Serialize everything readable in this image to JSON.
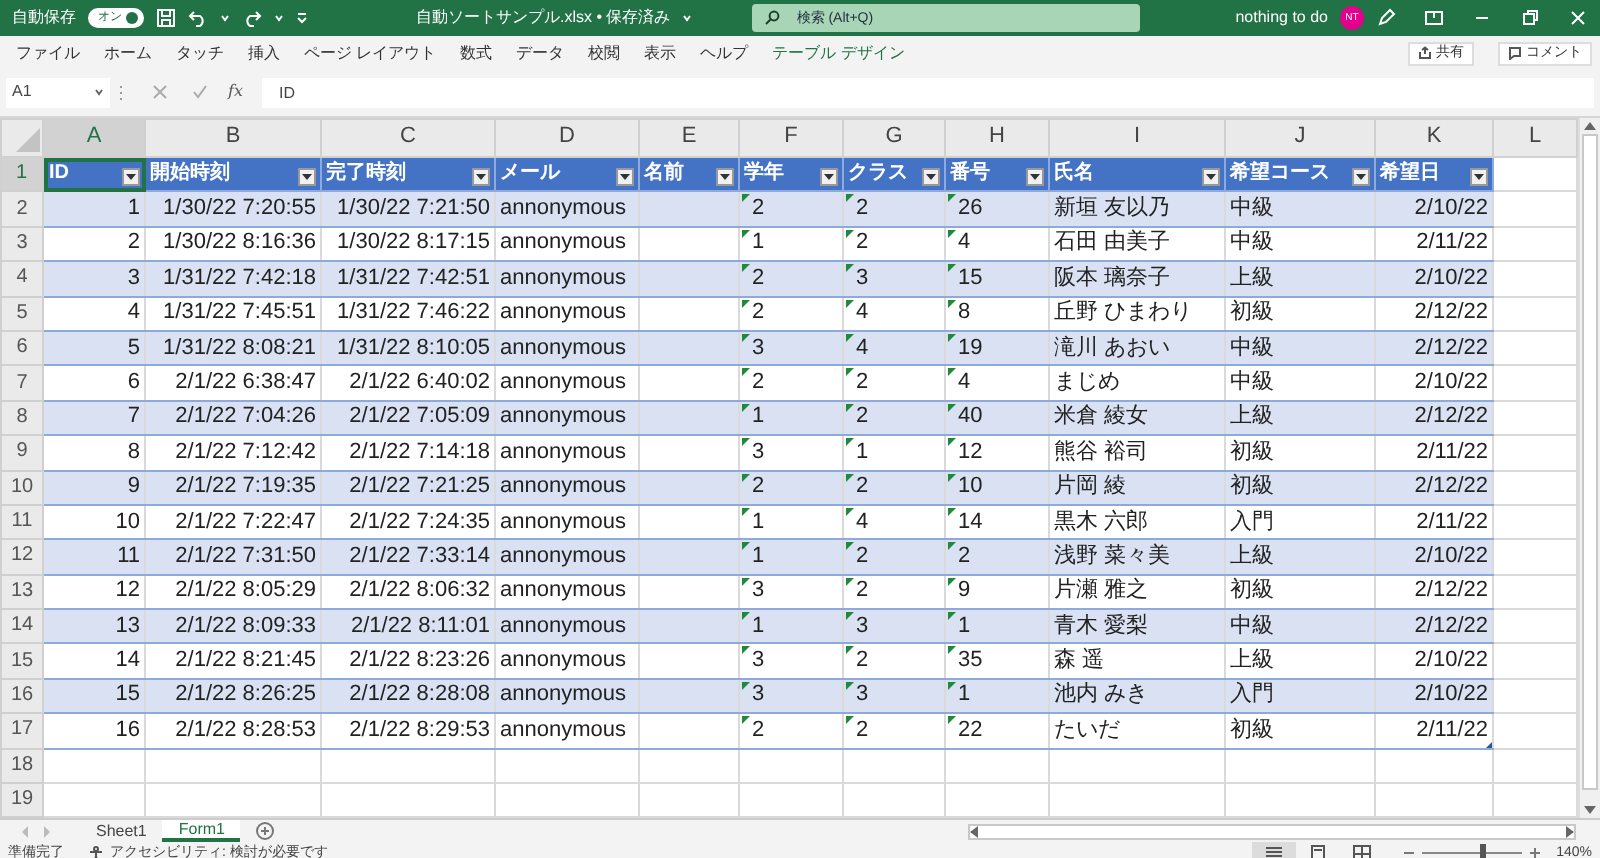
{
  "title_bar": {
    "autosave_label": "自動保存",
    "autosave_toggle": {
      "label": "オン",
      "on": true
    },
    "file_title": "自動ソートサンプル.xlsx • 保存済み",
    "search_placeholder": "検索 (Alt+Q)",
    "user_name": "nothing to do",
    "avatar_initials": "NT"
  },
  "ribbon_tabs": [
    {
      "label": "ファイル",
      "kind": "standard",
      "selected": false
    },
    {
      "label": "ホーム",
      "kind": "standard",
      "selected": false
    },
    {
      "label": "タッチ",
      "kind": "standard",
      "selected": false
    },
    {
      "label": "挿入",
      "kind": "standard",
      "selected": false
    },
    {
      "label": "ページ レイアウト",
      "kind": "standard",
      "selected": false
    },
    {
      "label": "数式",
      "kind": "standard",
      "selected": false
    },
    {
      "label": "データ",
      "kind": "standard",
      "selected": false
    },
    {
      "label": "校閲",
      "kind": "standard",
      "selected": false
    },
    {
      "label": "表示",
      "kind": "standard",
      "selected": false
    },
    {
      "label": "ヘルプ",
      "kind": "standard",
      "selected": false
    },
    {
      "label": "テーブル デザイン",
      "kind": "contextual",
      "selected": false
    }
  ],
  "share_button": "共有",
  "comment_button": "コメント",
  "formula_bar": {
    "name_box": "A1",
    "function_label": "fx",
    "value": "ID"
  },
  "sheet": {
    "columns": [
      {
        "letter": "A",
        "selected": true
      },
      {
        "letter": "B",
        "selected": false
      },
      {
        "letter": "C",
        "selected": false
      },
      {
        "letter": "D",
        "selected": false
      },
      {
        "letter": "E",
        "selected": false
      },
      {
        "letter": "F",
        "selected": false
      },
      {
        "letter": "G",
        "selected": false
      },
      {
        "letter": "H",
        "selected": false
      },
      {
        "letter": "I",
        "selected": false
      },
      {
        "letter": "J",
        "selected": false
      },
      {
        "letter": "K",
        "selected": false
      },
      {
        "letter": "L",
        "selected": false
      }
    ],
    "rows": [
      {
        "number": "1",
        "selected": true
      },
      {
        "number": "2",
        "selected": false
      },
      {
        "number": "3",
        "selected": false
      },
      {
        "number": "4",
        "selected": false
      },
      {
        "number": "5",
        "selected": false
      },
      {
        "number": "6",
        "selected": false
      },
      {
        "number": "7",
        "selected": false
      },
      {
        "number": "8",
        "selected": false
      },
      {
        "number": "9",
        "selected": false
      },
      {
        "number": "10",
        "selected": false
      },
      {
        "number": "11",
        "selected": false
      },
      {
        "number": "12",
        "selected": false
      },
      {
        "number": "13",
        "selected": false
      },
      {
        "number": "14",
        "selected": false
      },
      {
        "number": "15",
        "selected": false
      },
      {
        "number": "16",
        "selected": false
      },
      {
        "number": "17",
        "selected": false
      },
      {
        "number": "18",
        "selected": false
      },
      {
        "number": "19",
        "selected": false
      }
    ],
    "table": {
      "columns": [
        {
          "label": "ID",
          "kind": "number"
        },
        {
          "label": "開始時刻",
          "kind": "number"
        },
        {
          "label": "完了時刻",
          "kind": "number"
        },
        {
          "label": "メール",
          "kind": "text"
        },
        {
          "label": "名前",
          "kind": "text"
        },
        {
          "label": "学年",
          "kind": "text_number"
        },
        {
          "label": "クラス",
          "kind": "text_number"
        },
        {
          "label": "番号",
          "kind": "text_number"
        },
        {
          "label": "氏名",
          "kind": "text"
        },
        {
          "label": "希望コース",
          "kind": "text"
        },
        {
          "label": "希望日",
          "kind": "number"
        }
      ],
      "rows": [
        [
          "1",
          "1/30/22 7:20:55",
          "1/30/22 7:21:50",
          "annonymous",
          null,
          "2",
          "2",
          "26",
          "新垣 友以乃",
          "中級",
          "2/10/22"
        ],
        [
          "2",
          "1/30/22 8:16:36",
          "1/30/22 8:17:15",
          "annonymous",
          null,
          "1",
          "2",
          "4",
          "石田 由美子",
          "中級",
          "2/11/22"
        ],
        [
          "3",
          "1/31/22 7:42:18",
          "1/31/22 7:42:51",
          "annonymous",
          null,
          "2",
          "3",
          "15",
          "阪本 璃奈子",
          "上級",
          "2/10/22"
        ],
        [
          "4",
          "1/31/22 7:45:51",
          "1/31/22 7:46:22",
          "annonymous",
          null,
          "2",
          "4",
          "8",
          "丘野 ひまわり",
          "初級",
          "2/12/22"
        ],
        [
          "5",
          "1/31/22 8:08:21",
          "1/31/22 8:10:05",
          "annonymous",
          null,
          "3",
          "4",
          "19",
          "滝川 あおい",
          "中級",
          "2/12/22"
        ],
        [
          "6",
          "2/1/22 6:38:47",
          "2/1/22 6:40:02",
          "annonymous",
          null,
          "2",
          "2",
          "4",
          "まじめ",
          "中級",
          "2/10/22"
        ],
        [
          "7",
          "2/1/22 7:04:26",
          "2/1/22 7:05:09",
          "annonymous",
          null,
          "1",
          "2",
          "40",
          "米倉 綾女",
          "上級",
          "2/12/22"
        ],
        [
          "8",
          "2/1/22 7:12:42",
          "2/1/22 7:14:18",
          "annonymous",
          null,
          "3",
          "1",
          "12",
          "熊谷 裕司",
          "初級",
          "2/11/22"
        ],
        [
          "9",
          "2/1/22 7:19:35",
          "2/1/22 7:21:25",
          "annonymous",
          null,
          "2",
          "2",
          "10",
          "片岡 綾",
          "初級",
          "2/12/22"
        ],
        [
          "10",
          "2/1/22 7:22:47",
          "2/1/22 7:24:35",
          "annonymous",
          null,
          "1",
          "4",
          "14",
          "黒木 六郎",
          "入門",
          "2/11/22"
        ],
        [
          "11",
          "2/1/22 7:31:50",
          "2/1/22 7:33:14",
          "annonymous",
          null,
          "1",
          "2",
          "2",
          "浅野 菜々美",
          "上級",
          "2/10/22"
        ],
        [
          "12",
          "2/1/22 8:05:29",
          "2/1/22 8:06:32",
          "annonymous",
          null,
          "3",
          "2",
          "9",
          "片瀬 雅之",
          "初級",
          "2/12/22"
        ],
        [
          "13",
          "2/1/22 8:09:33",
          "2/1/22 8:11:01",
          "annonymous",
          null,
          "1",
          "3",
          "1",
          "青木 愛梨",
          "中級",
          "2/12/22"
        ],
        [
          "14",
          "2/1/22 8:21:45",
          "2/1/22 8:23:26",
          "annonymous",
          null,
          "3",
          "2",
          "35",
          "森 遥",
          "上級",
          "2/10/22"
        ],
        [
          "15",
          "2/1/22 8:26:25",
          "2/1/22 8:28:08",
          "annonymous",
          null,
          "3",
          "3",
          "1",
          "池内 みき",
          "入門",
          "2/10/22"
        ],
        [
          "16",
          "2/1/22 8:28:53",
          "2/1/22 8:29:53",
          "annonymous",
          null,
          "2",
          "2",
          "22",
          "たいだ",
          "初級",
          "2/11/22"
        ]
      ]
    }
  },
  "sheet_tabs": [
    {
      "label": "Sheet1",
      "selected": false
    },
    {
      "label": "Form1",
      "selected": true
    }
  ],
  "status_bar": {
    "ready": "準備完了",
    "accessibility": "アクセシビリティ: 検討が必要です",
    "views": [
      {
        "kind": "normal",
        "selected": true
      },
      {
        "kind": "page_layout",
        "selected": false
      },
      {
        "kind": "page_break",
        "selected": false
      }
    ],
    "zoom": {
      "level": 0.58,
      "label": "140%"
    }
  }
}
